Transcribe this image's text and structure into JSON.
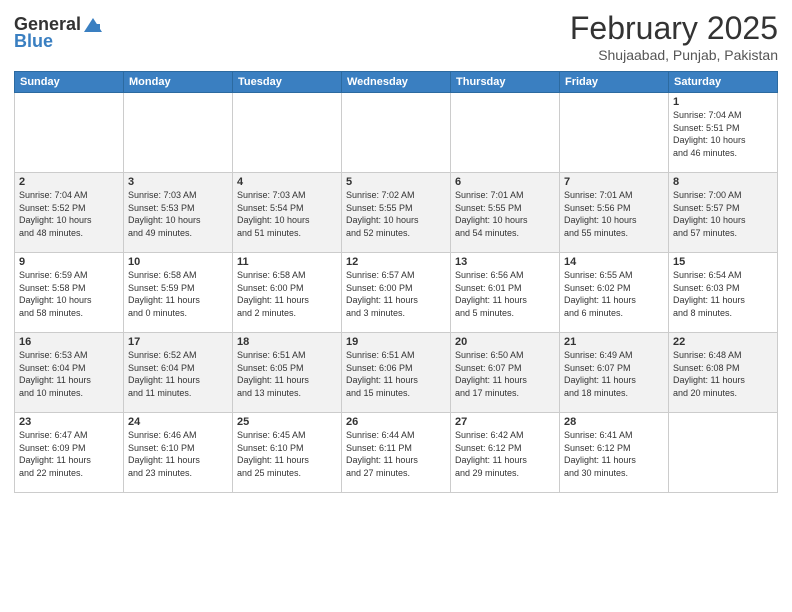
{
  "header": {
    "logo_general": "General",
    "logo_blue": "Blue",
    "month_title": "February 2025",
    "location": "Shujaabad, Punjab, Pakistan"
  },
  "weekdays": [
    "Sunday",
    "Monday",
    "Tuesday",
    "Wednesday",
    "Thursday",
    "Friday",
    "Saturday"
  ],
  "weeks": [
    [
      {
        "day": "",
        "info": ""
      },
      {
        "day": "",
        "info": ""
      },
      {
        "day": "",
        "info": ""
      },
      {
        "day": "",
        "info": ""
      },
      {
        "day": "",
        "info": ""
      },
      {
        "day": "",
        "info": ""
      },
      {
        "day": "1",
        "info": "Sunrise: 7:04 AM\nSunset: 5:51 PM\nDaylight: 10 hours\nand 46 minutes."
      }
    ],
    [
      {
        "day": "2",
        "info": "Sunrise: 7:04 AM\nSunset: 5:52 PM\nDaylight: 10 hours\nand 48 minutes."
      },
      {
        "day": "3",
        "info": "Sunrise: 7:03 AM\nSunset: 5:53 PM\nDaylight: 10 hours\nand 49 minutes."
      },
      {
        "day": "4",
        "info": "Sunrise: 7:03 AM\nSunset: 5:54 PM\nDaylight: 10 hours\nand 51 minutes."
      },
      {
        "day": "5",
        "info": "Sunrise: 7:02 AM\nSunset: 5:55 PM\nDaylight: 10 hours\nand 52 minutes."
      },
      {
        "day": "6",
        "info": "Sunrise: 7:01 AM\nSunset: 5:55 PM\nDaylight: 10 hours\nand 54 minutes."
      },
      {
        "day": "7",
        "info": "Sunrise: 7:01 AM\nSunset: 5:56 PM\nDaylight: 10 hours\nand 55 minutes."
      },
      {
        "day": "8",
        "info": "Sunrise: 7:00 AM\nSunset: 5:57 PM\nDaylight: 10 hours\nand 57 minutes."
      }
    ],
    [
      {
        "day": "9",
        "info": "Sunrise: 6:59 AM\nSunset: 5:58 PM\nDaylight: 10 hours\nand 58 minutes."
      },
      {
        "day": "10",
        "info": "Sunrise: 6:58 AM\nSunset: 5:59 PM\nDaylight: 11 hours\nand 0 minutes."
      },
      {
        "day": "11",
        "info": "Sunrise: 6:58 AM\nSunset: 6:00 PM\nDaylight: 11 hours\nand 2 minutes."
      },
      {
        "day": "12",
        "info": "Sunrise: 6:57 AM\nSunset: 6:00 PM\nDaylight: 11 hours\nand 3 minutes."
      },
      {
        "day": "13",
        "info": "Sunrise: 6:56 AM\nSunset: 6:01 PM\nDaylight: 11 hours\nand 5 minutes."
      },
      {
        "day": "14",
        "info": "Sunrise: 6:55 AM\nSunset: 6:02 PM\nDaylight: 11 hours\nand 6 minutes."
      },
      {
        "day": "15",
        "info": "Sunrise: 6:54 AM\nSunset: 6:03 PM\nDaylight: 11 hours\nand 8 minutes."
      }
    ],
    [
      {
        "day": "16",
        "info": "Sunrise: 6:53 AM\nSunset: 6:04 PM\nDaylight: 11 hours\nand 10 minutes."
      },
      {
        "day": "17",
        "info": "Sunrise: 6:52 AM\nSunset: 6:04 PM\nDaylight: 11 hours\nand 11 minutes."
      },
      {
        "day": "18",
        "info": "Sunrise: 6:51 AM\nSunset: 6:05 PM\nDaylight: 11 hours\nand 13 minutes."
      },
      {
        "day": "19",
        "info": "Sunrise: 6:51 AM\nSunset: 6:06 PM\nDaylight: 11 hours\nand 15 minutes."
      },
      {
        "day": "20",
        "info": "Sunrise: 6:50 AM\nSunset: 6:07 PM\nDaylight: 11 hours\nand 17 minutes."
      },
      {
        "day": "21",
        "info": "Sunrise: 6:49 AM\nSunset: 6:07 PM\nDaylight: 11 hours\nand 18 minutes."
      },
      {
        "day": "22",
        "info": "Sunrise: 6:48 AM\nSunset: 6:08 PM\nDaylight: 11 hours\nand 20 minutes."
      }
    ],
    [
      {
        "day": "23",
        "info": "Sunrise: 6:47 AM\nSunset: 6:09 PM\nDaylight: 11 hours\nand 22 minutes."
      },
      {
        "day": "24",
        "info": "Sunrise: 6:46 AM\nSunset: 6:10 PM\nDaylight: 11 hours\nand 23 minutes."
      },
      {
        "day": "25",
        "info": "Sunrise: 6:45 AM\nSunset: 6:10 PM\nDaylight: 11 hours\nand 25 minutes."
      },
      {
        "day": "26",
        "info": "Sunrise: 6:44 AM\nSunset: 6:11 PM\nDaylight: 11 hours\nand 27 minutes."
      },
      {
        "day": "27",
        "info": "Sunrise: 6:42 AM\nSunset: 6:12 PM\nDaylight: 11 hours\nand 29 minutes."
      },
      {
        "day": "28",
        "info": "Sunrise: 6:41 AM\nSunset: 6:12 PM\nDaylight: 11 hours\nand 30 minutes."
      },
      {
        "day": "",
        "info": ""
      }
    ]
  ]
}
